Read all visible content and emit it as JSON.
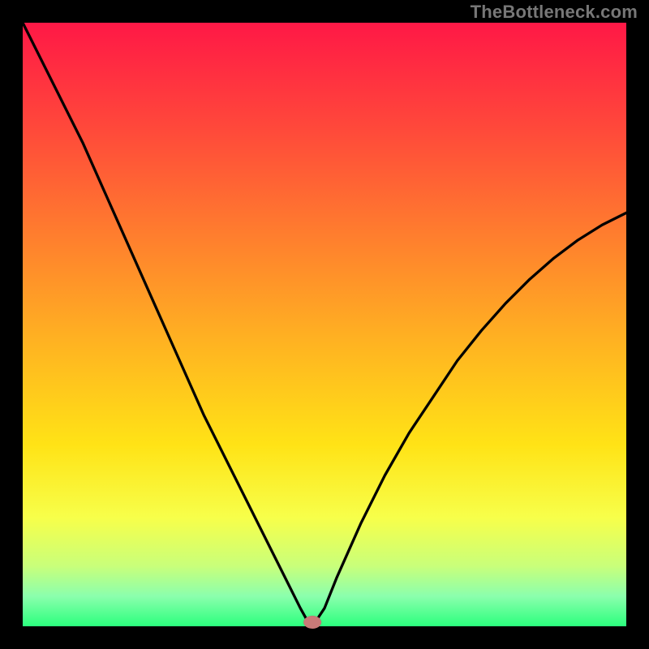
{
  "watermark": "TheBottleneck.com",
  "chart_data": {
    "type": "line",
    "title": "",
    "xlabel": "",
    "ylabel": "",
    "xlim": [
      0,
      100
    ],
    "ylim": [
      0,
      100
    ],
    "grid": false,
    "series": [
      {
        "name": "curve",
        "x": [
          0,
          3,
          6,
          10,
          14,
          18,
          22,
          26,
          30,
          34,
          38,
          42,
          44,
          46,
          47,
          48,
          50,
          52,
          56,
          60,
          64,
          68,
          72,
          76,
          80,
          84,
          88,
          92,
          96,
          100
        ],
        "values": [
          100,
          94,
          88,
          80,
          71,
          62,
          53,
          44,
          35,
          27,
          19,
          11,
          7,
          3,
          1.2,
          0,
          3,
          8,
          17,
          25,
          32,
          38,
          44,
          49,
          53.5,
          57.5,
          61,
          64,
          66.5,
          68.5
        ]
      }
    ],
    "minimum_marker": {
      "x": 48,
      "y": 0
    },
    "colors": {
      "gradient_top": "#ff1846",
      "gradient_bottom": "#2bff7d",
      "curve": "#000000",
      "min_dot": "#c97a78",
      "frame": "#000000"
    }
  }
}
